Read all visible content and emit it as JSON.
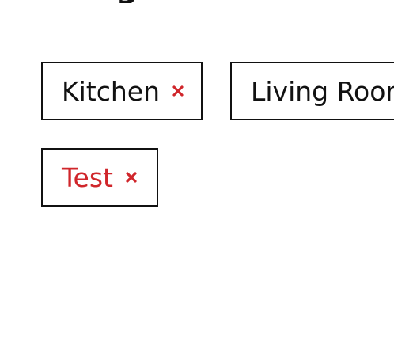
{
  "heading": {
    "visible_fragment": "g"
  },
  "tags": [
    {
      "label": "Kitchen",
      "removable": true,
      "remove_icon": "close-icon",
      "remove_color": "#d0262b"
    },
    {
      "label": "Living Roor",
      "removable": true,
      "remove_icon": "close-icon",
      "remove_color": "#d0262b"
    },
    {
      "label": "Test",
      "removable": true,
      "remove_icon": "close-icon",
      "remove_color": "#d0262b",
      "label_color": "#d0262b"
    }
  ]
}
